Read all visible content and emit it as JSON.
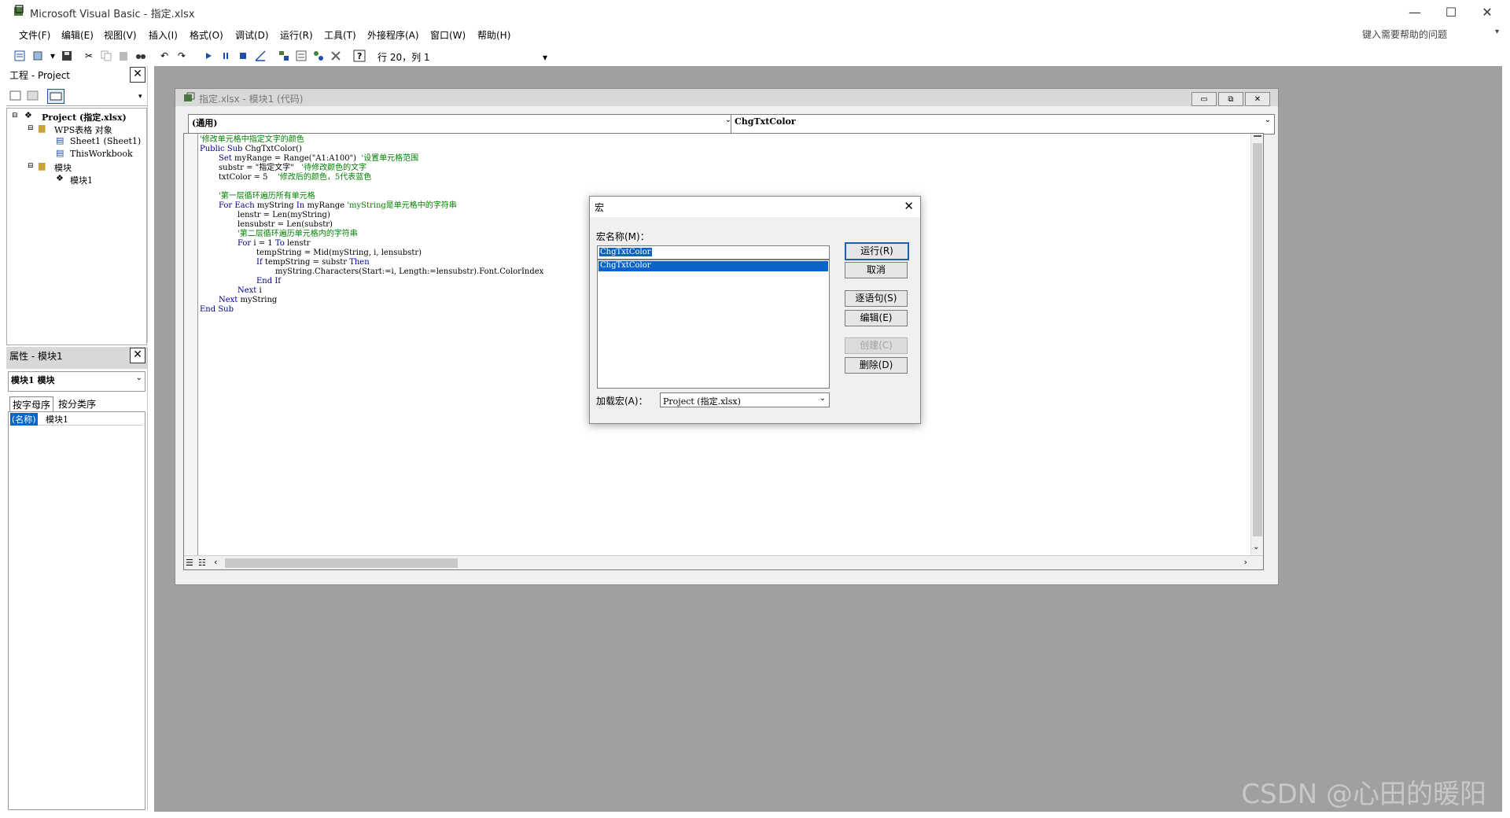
{
  "window": {
    "title": "Microsoft Visual Basic - 指定.xlsx",
    "minimize": "—",
    "maximize": "☐",
    "close": "✕"
  },
  "menu": [
    "文件(F)",
    "编辑(E)",
    "视图(V)",
    "插入(I)",
    "格式(O)",
    "调试(D)",
    "运行(R)",
    "工具(T)",
    "外接程序(A)",
    "窗口(W)",
    "帮助(H)"
  ],
  "help_box": {
    "placeholder": "键入需要帮助的问题"
  },
  "toolbar": {
    "cursor_position": "行 20，列 1"
  },
  "project_pane": {
    "title": "工程 - Project",
    "tree": {
      "project": "Project (指定.xlsx)",
      "objects_folder": "WPS表格 对象",
      "sheet1": "Sheet1 (Sheet1)",
      "thisworkbook": "ThisWorkbook",
      "modules_folder": "模块",
      "module1": "模块1"
    }
  },
  "properties_pane": {
    "title": "属性 - 模块1",
    "object_combo": "模块1 模块",
    "tab_alpha": "按字母序",
    "tab_category": "按分类序",
    "prop_name": "(名称)",
    "prop_value": "模块1"
  },
  "code_window": {
    "title": "指定.xlsx - 模块1 (代码)",
    "object_combo": "(通用)",
    "procedure_combo": "ChgTxtColor",
    "lines": [
      {
        "indent": 0,
        "parts": [
          {
            "t": "'修改单元格中指定文字的颜色",
            "c": "cm"
          }
        ]
      },
      {
        "indent": 0,
        "parts": [
          {
            "t": "Public Sub ",
            "c": "kw"
          },
          {
            "t": "ChgTxtColor()",
            "c": ""
          }
        ]
      },
      {
        "indent": 1,
        "parts": [
          {
            "t": "Set ",
            "c": "kw"
          },
          {
            "t": "myRange = Range(\"A1:A100\")  ",
            "c": ""
          },
          {
            "t": "'设置单元格范围",
            "c": "cm"
          }
        ]
      },
      {
        "indent": 1,
        "parts": [
          {
            "t": "substr = \"指定文字\"   ",
            "c": ""
          },
          {
            "t": "'待修改颜色的文字",
            "c": "cm"
          }
        ]
      },
      {
        "indent": 1,
        "parts": [
          {
            "t": "txtColor = 5    ",
            "c": ""
          },
          {
            "t": "'修改后的颜色，5代表蓝色",
            "c": "cm"
          }
        ]
      },
      {
        "indent": 0,
        "parts": [
          {
            "t": "",
            "c": ""
          }
        ]
      },
      {
        "indent": 1,
        "parts": [
          {
            "t": "'第一层循环遍历所有单元格",
            "c": "cm"
          }
        ]
      },
      {
        "indent": 1,
        "parts": [
          {
            "t": "For Each ",
            "c": "kw"
          },
          {
            "t": "myString ",
            "c": ""
          },
          {
            "t": "In ",
            "c": "kw"
          },
          {
            "t": "myRange ",
            "c": ""
          },
          {
            "t": "'myString是单元格中的字符串",
            "c": "cm"
          }
        ]
      },
      {
        "indent": 2,
        "parts": [
          {
            "t": "lenstr = Len(myString)",
            "c": ""
          }
        ]
      },
      {
        "indent": 2,
        "parts": [
          {
            "t": "lensubstr = Len(substr)",
            "c": ""
          }
        ]
      },
      {
        "indent": 2,
        "parts": [
          {
            "t": "'第二层循环遍历单元格内的字符串",
            "c": "cm"
          }
        ]
      },
      {
        "indent": 2,
        "parts": [
          {
            "t": "For ",
            "c": "kw"
          },
          {
            "t": "i = 1 ",
            "c": ""
          },
          {
            "t": "To ",
            "c": "kw"
          },
          {
            "t": "lenstr",
            "c": ""
          }
        ]
      },
      {
        "indent": 3,
        "parts": [
          {
            "t": "tempString = Mid(myString, i, lensubstr)",
            "c": ""
          }
        ]
      },
      {
        "indent": 3,
        "parts": [
          {
            "t": "If ",
            "c": "kw"
          },
          {
            "t": "tempString = substr ",
            "c": ""
          },
          {
            "t": "Then",
            "c": "kw"
          }
        ]
      },
      {
        "indent": 4,
        "parts": [
          {
            "t": "myString.Characters(Start:=i, Length:=lensubstr).Font.ColorIndex",
            "c": ""
          }
        ]
      },
      {
        "indent": 3,
        "parts": [
          {
            "t": "End If",
            "c": "kw"
          }
        ]
      },
      {
        "indent": 2,
        "parts": [
          {
            "t": "Next ",
            "c": "kw"
          },
          {
            "t": "i",
            "c": ""
          }
        ]
      },
      {
        "indent": 1,
        "parts": [
          {
            "t": "Next ",
            "c": "kw"
          },
          {
            "t": "myString",
            "c": ""
          }
        ]
      },
      {
        "indent": 0,
        "parts": [
          {
            "t": "End Sub",
            "c": "kw"
          }
        ]
      }
    ]
  },
  "macro_dialog": {
    "title": "宏",
    "name_label": "宏名称(M)：",
    "name_value": "ChgTxtColor",
    "list_items": [
      "ChgTxtColor"
    ],
    "buttons": {
      "run": "运行(R)",
      "cancel": "取消",
      "step": "逐语句(S)",
      "edit": "编辑(E)",
      "create": "创建(C)",
      "delete": "删除(D)"
    },
    "location_label": "加载宏(A)：",
    "location_value": "Project (指定.xlsx)"
  },
  "watermark": "CSDN @心田的暖阳",
  "colors": {
    "selection": "#0a64c8",
    "comment": "#008000",
    "keyword": "#00008b",
    "mdi_background": "#a0a0a0"
  }
}
